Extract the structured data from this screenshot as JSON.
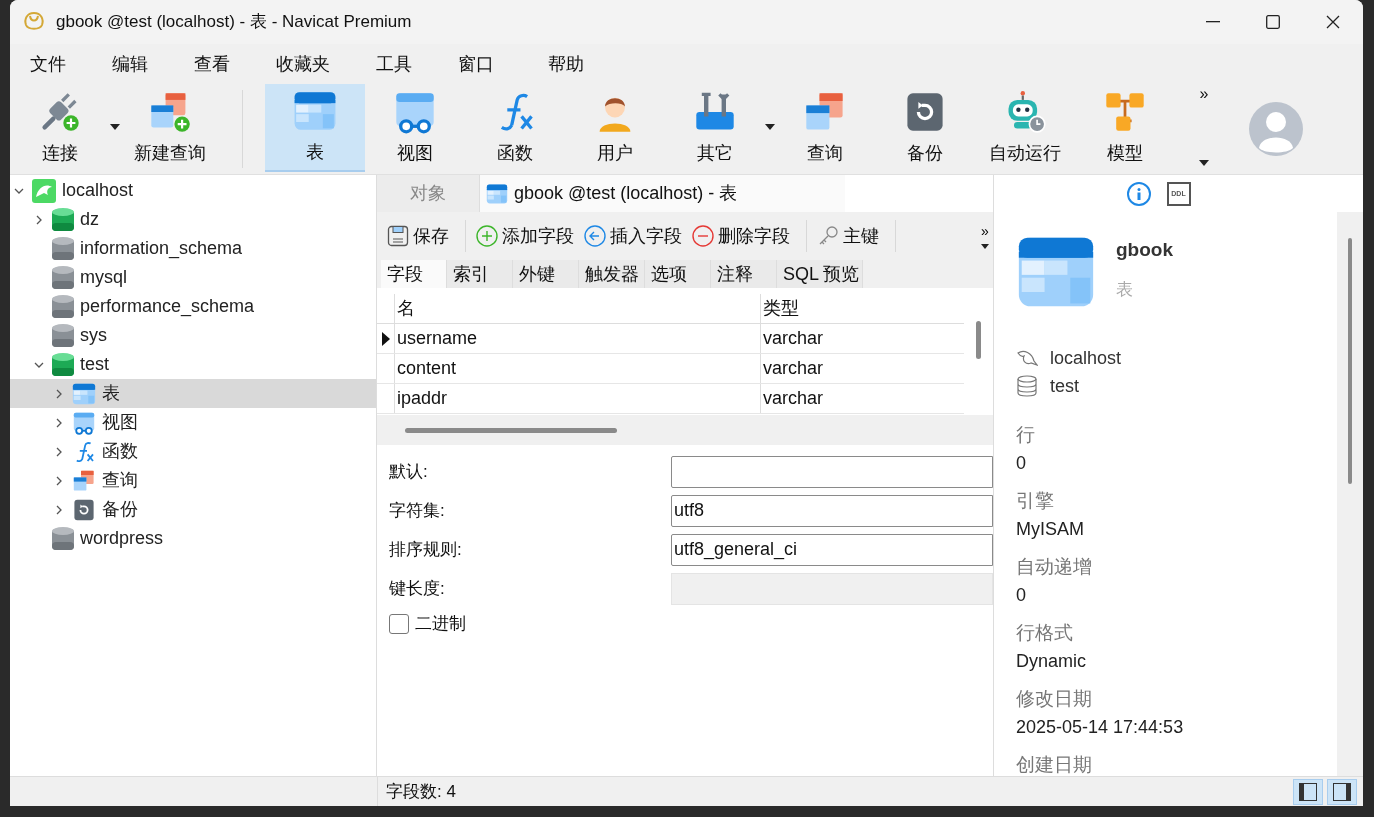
{
  "window": {
    "title": "gbook @test (localhost) - 表 - Navicat Premium"
  },
  "menu": [
    "文件",
    "编辑",
    "查看",
    "收藏夹",
    "工具",
    "窗口",
    "帮助"
  ],
  "toolbar": [
    {
      "label": "连接",
      "kind": "connect",
      "dropdown": true,
      "selected": false
    },
    {
      "label": "新建查询",
      "kind": "new-query",
      "dropdown": false,
      "selected": false
    },
    {
      "label": "表",
      "kind": "table",
      "dropdown": false,
      "selected": true
    },
    {
      "label": "视图",
      "kind": "view",
      "dropdown": false,
      "selected": false
    },
    {
      "label": "函数",
      "kind": "function",
      "dropdown": false,
      "selected": false
    },
    {
      "label": "用户",
      "kind": "user",
      "dropdown": false,
      "selected": false
    },
    {
      "label": "其它",
      "kind": "other",
      "dropdown": true,
      "selected": false
    },
    {
      "label": "查询",
      "kind": "query",
      "dropdown": false,
      "selected": false
    },
    {
      "label": "备份",
      "kind": "backup",
      "dropdown": false,
      "selected": false
    },
    {
      "label": "自动运行",
      "kind": "automation",
      "dropdown": false,
      "selected": false
    },
    {
      "label": "模型",
      "kind": "model",
      "dropdown": false,
      "selected": false
    }
  ],
  "tree": [
    {
      "label": "localhost",
      "kind": "server",
      "expanded": true,
      "selected": false,
      "children": [
        {
          "label": "dz",
          "kind": "database",
          "open": true,
          "expanded": false,
          "selected": false
        },
        {
          "label": "information_schema",
          "kind": "database",
          "open": false,
          "expanded": false,
          "selected": false
        },
        {
          "label": "mysql",
          "kind": "database",
          "open": false,
          "expanded": false,
          "selected": false
        },
        {
          "label": "performance_schema",
          "kind": "database",
          "open": false,
          "expanded": false,
          "selected": false
        },
        {
          "label": "sys",
          "kind": "database",
          "open": false,
          "expanded": false,
          "selected": false
        },
        {
          "label": "test",
          "kind": "database",
          "open": true,
          "expanded": true,
          "selected": false,
          "children": [
            {
              "label": "表",
              "kind": "table",
              "expanded": false,
              "selected": true
            },
            {
              "label": "视图",
              "kind": "view",
              "expanded": false,
              "selected": false
            },
            {
              "label": "函数",
              "kind": "function",
              "expanded": false,
              "selected": false
            },
            {
              "label": "查询",
              "kind": "query",
              "expanded": false,
              "selected": false
            },
            {
              "label": "备份",
              "kind": "backup",
              "expanded": false,
              "selected": false
            }
          ]
        },
        {
          "label": "wordpress",
          "kind": "database",
          "open": false,
          "expanded": false,
          "selected": false
        }
      ]
    }
  ],
  "tabs": [
    {
      "label": "对象",
      "selected": false
    },
    {
      "label": "gbook @test (localhost) - 表",
      "selected": true
    }
  ],
  "editor_toolbar": [
    {
      "label": "保存",
      "kind": "save"
    },
    {
      "label": "添加字段",
      "kind": "add"
    },
    {
      "label": "插入字段",
      "kind": "insert"
    },
    {
      "label": "删除字段",
      "kind": "delete"
    },
    {
      "label": "主键",
      "kind": "key"
    }
  ],
  "sub_tabs": [
    {
      "label": "字段",
      "selected": true
    },
    {
      "label": "索引",
      "selected": false
    },
    {
      "label": "外键",
      "selected": false
    },
    {
      "label": "触发器",
      "selected": false
    },
    {
      "label": "选项",
      "selected": false
    },
    {
      "label": "注释",
      "selected": false
    },
    {
      "label": "SQL 预览",
      "selected": false
    }
  ],
  "fields_table": {
    "columns": [
      "名",
      "类型"
    ],
    "rows": [
      {
        "name": "username",
        "type": "varchar",
        "current": true
      },
      {
        "name": "content",
        "type": "varchar",
        "current": false
      },
      {
        "name": "ipaddr",
        "type": "varchar",
        "current": false
      }
    ]
  },
  "toolbar_more": "»",
  "editor_toolbar_more": "»",
  "field_properties": [
    {
      "label": "默认:",
      "disabled": false
    },
    {
      "label": "字符集:",
      "value": "utf8",
      "disabled": false
    },
    {
      "label": "排序规则:",
      "value": "utf8_general_ci",
      "disabled": false
    },
    {
      "label": "键长度:",
      "disabled": true
    }
  ],
  "binary_checkbox": {
    "label": "二进制",
    "checked": false
  },
  "status_bar": {
    "text": "字段数: 4",
    "layout_buttons": [
      {
        "selected": true
      },
      {
        "selected": true
      }
    ]
  },
  "info_panel": {
    "tabs": [
      {
        "kind": "info",
        "selected": true
      },
      {
        "kind": "ddl",
        "label": "DDL",
        "selected": false
      }
    ],
    "name": "gbook",
    "type": "表",
    "connection": "localhost",
    "database": "test",
    "properties": [
      {
        "label": "行",
        "value": "0"
      },
      {
        "label": "引擎",
        "value": "MyISAM"
      },
      {
        "label": "自动递增",
        "value": "0"
      },
      {
        "label": "行格式",
        "value": "Dynamic"
      },
      {
        "label": "修改日期",
        "value": "2025-05-14 17:44:53"
      },
      {
        "label": "创建日期"
      }
    ]
  }
}
